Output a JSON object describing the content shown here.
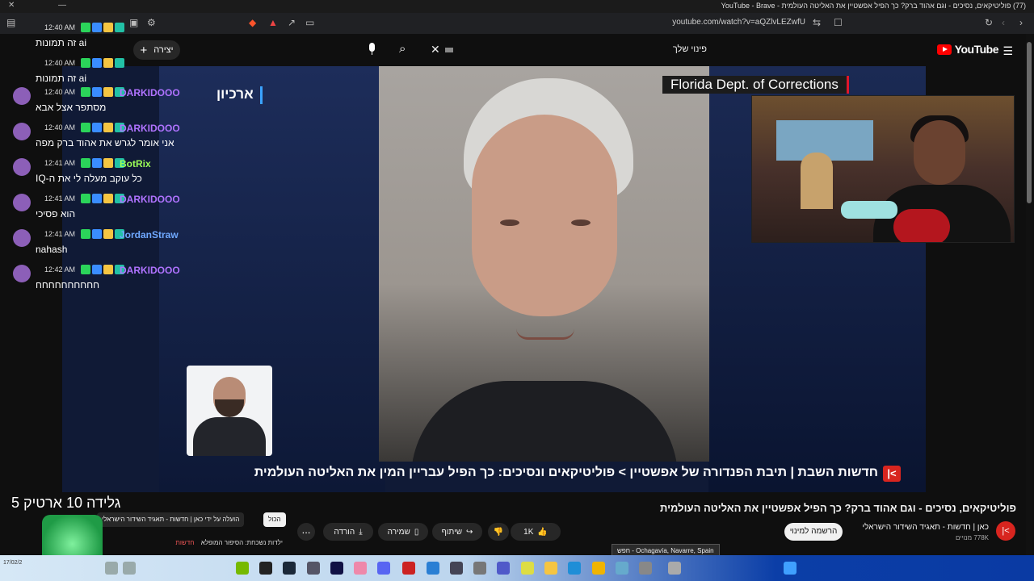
{
  "browser": {
    "window_title": "(77) פוליטיקאים, נסיכים - וגם אהוד ברק? כך הפיל אפשטיין את האליטה העולמית - YouTube - Brave",
    "url": "youtube.com/watch?v=aQZlvLEZwfU"
  },
  "youtube": {
    "logo_text": "YouTube",
    "search_query": "פינוי שלך",
    "create_label": "יצירה",
    "brand_color": "#ff0000"
  },
  "video": {
    "source_caption": "Florida Dept. of Corrections",
    "archive_tag": "ארכיון",
    "ticker": {
      "brand": "|<",
      "text": "חדשות השבת  |  תיבת הפנדורה של אפשטיין  >  פוליטיקאים ונסיכים: כך הפיל עבריין המין את האליטה העולמית"
    }
  },
  "chat": {
    "messages": [
      {
        "time": "12:40 AM",
        "name": "",
        "text": "ai זה תמונות",
        "color": "#ffffff"
      },
      {
        "time": "12:40 AM",
        "name": "",
        "text": "ai זה תמונות",
        "color": "#ffffff"
      },
      {
        "time": "12:40 AM",
        "name": "DARKIDOOO",
        "text": "מסתפר אצל אבא",
        "color": "#b073ff"
      },
      {
        "time": "12:40 AM",
        "name": "DARKIDOOO",
        "text": "אני אומר לגרש את אהוד ברק מפה",
        "color": "#b073ff"
      },
      {
        "time": "12:41 AM",
        "name": "BotRix",
        "text": "כל עוקב מעלה לי את ה-IQ",
        "color": "#9cff57"
      },
      {
        "time": "12:41 AM",
        "name": "DARKIDOOO",
        "text": "הוא פסיכי",
        "color": "#b073ff"
      },
      {
        "time": "12:41 AM",
        "name": "JordanStraw",
        "text": "nahash",
        "color": "#6fa8ff"
      },
      {
        "time": "12:42 AM",
        "name": "DARKIDOOO",
        "text": "חחחחחחחחחח",
        "color": "#b073ff"
      }
    ]
  },
  "details": {
    "title": "פוליטיקאים, נסיכים - וגם אהוד ברק? כך הפיל אפשטיין את האליטה העולמית",
    "channel_logo": "|<",
    "channel_name": "כאן | חדשות - תאגיד השידור הישראלי",
    "subscribers": "778K מנויים",
    "subscribe_label": "הרשמה למינוי",
    "like_count": "1K",
    "share_label": "שיתוף",
    "save_label": "שמירה",
    "download_label": "הורדה",
    "more_label": "..."
  },
  "recommendations": {
    "chip_all": "הכול",
    "chip_uploader": "הועלה על ידי כאן | חדשות - תאגיד השידור הישראלי",
    "item_title": "ילדות נשכחת: הסיפור המופלא",
    "item_badge": "חדשות"
  },
  "overlay": {
    "stream_title": "גלידה 10 ארטיק 5"
  },
  "taskbar": {
    "tooltip": "Ochagavía, Navarre, Spain - חפש",
    "date": "17/02/2"
  }
}
